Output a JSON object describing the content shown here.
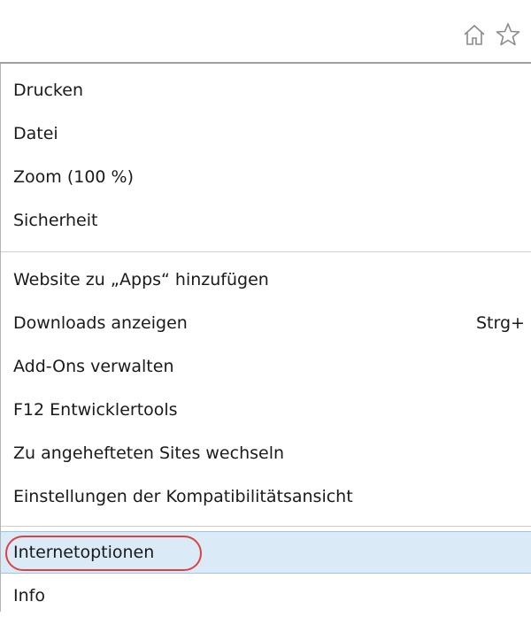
{
  "toolbar": {
    "home_icon": "home-icon",
    "favorites_icon": "star-icon"
  },
  "menu": {
    "group1": [
      {
        "label": "Drucken"
      },
      {
        "label": "Datei"
      },
      {
        "label": "Zoom (100 %)"
      },
      {
        "label": "Sicherheit"
      }
    ],
    "group2": [
      {
        "label": "Website zu „Apps“ hinzufügen"
      },
      {
        "label": "Downloads anzeigen",
        "shortcut": "Strg+"
      },
      {
        "label": "Add-Ons verwalten"
      },
      {
        "label": "F12 Entwicklertools"
      },
      {
        "label": "Zu angehefteten Sites wechseln"
      },
      {
        "label": "Einstellungen der Kompatibilitätsansicht"
      }
    ],
    "group3": [
      {
        "label": "Internetoptionen",
        "highlighted": true
      },
      {
        "label": "Info"
      }
    ]
  },
  "colors": {
    "highlight_bg": "#dbeaf7",
    "highlight_border": "#9cc5ea",
    "annotation_circle": "#d94343",
    "separator": "#cfcfcf"
  }
}
